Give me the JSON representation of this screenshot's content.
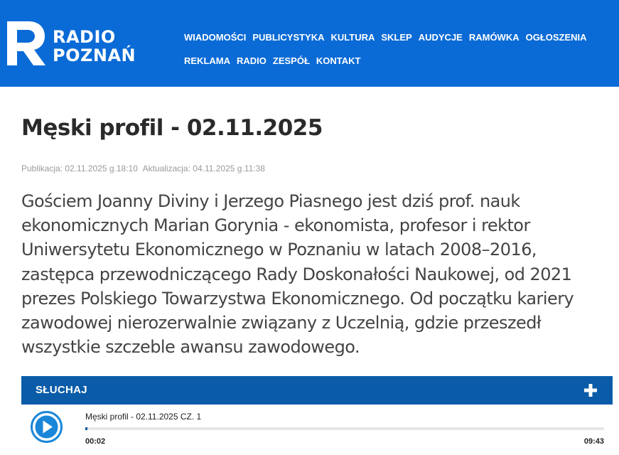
{
  "header": {
    "logo": {
      "line1": "RADIO",
      "line2": "POZNAŃ",
      "icon": "radio-poznan-r-logo-icon"
    },
    "nav_row1": [
      {
        "label": "WIADOMOŚCI"
      },
      {
        "label": "PUBLICYSTYKA"
      },
      {
        "label": "KULTURA"
      },
      {
        "label": "SKLEP"
      },
      {
        "label": "AUDYCJE"
      },
      {
        "label": "RAMÓWKA"
      },
      {
        "label": "OGŁOSZENIA"
      }
    ],
    "nav_row2": [
      {
        "label": "REKLAMA"
      },
      {
        "label": "RADIO"
      },
      {
        "label": "ZESPÓŁ"
      },
      {
        "label": "KONTAKT"
      }
    ],
    "background_color": "#0a6bd6"
  },
  "article": {
    "title": "Męski profil - 02.11.2025",
    "published": "Publikacja: 02.11.2025 g.18:10",
    "updated": "Aktualizacja: 04.11.2025 g.11:38",
    "lead": "Gościem Joanny Diviny i Jerzego Piasnego jest dziś prof. nauk ekonomicznych Marian Gorynia - ekonomista, profesor i rektor Uniwersytetu Ekonomicznego w Poznaniu w latach 2008–2016, zastępca przewodniczącego Rady Doskonałości Naukowej, od 2021 prezes Polskiego Towarzystwa Ekonomicznego. Od początku kariery zawodowej nierozerwalnie związany z Uczelnią, gdzie przeszedł wszystkie szczeble awansu zawodowego."
  },
  "listen": {
    "label": "SŁUCHAJ",
    "expand_icon": "plus-icon",
    "bar_color": "#0a5ca8"
  },
  "player": {
    "play_icon": "play-icon",
    "track_title": "Męski profil - 02.11.2025 CZ. 1",
    "current_time": "00:02",
    "total_time": "09:43",
    "progress_fraction": 0.0034
  }
}
